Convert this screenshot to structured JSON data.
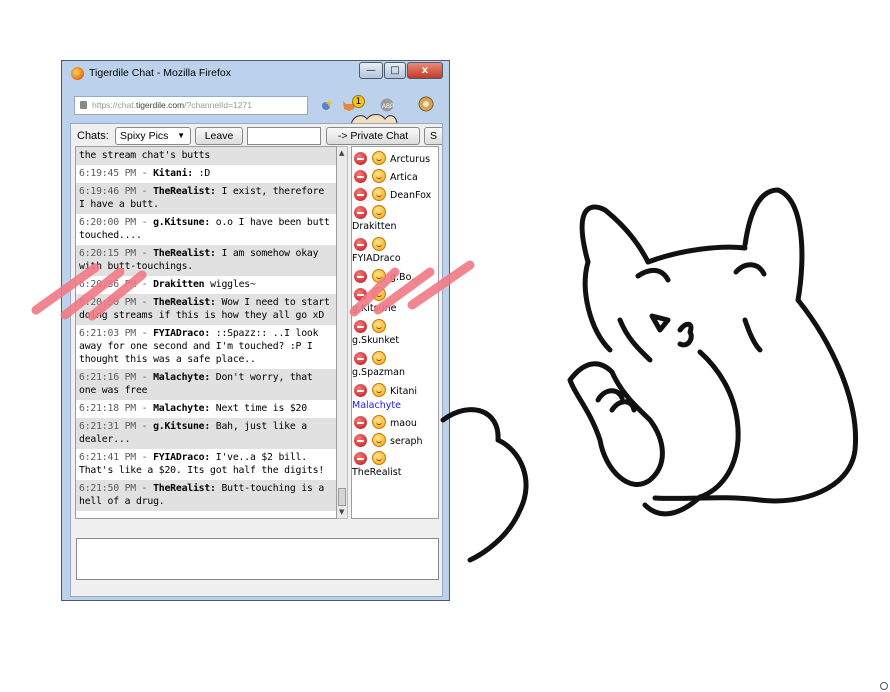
{
  "window": {
    "title": "Tigerdile Chat - Mozilla Firefox",
    "minimize_glyph": "—",
    "maximize_glyph": "□",
    "close_glyph": "x"
  },
  "urlbar": {
    "prefix": "https://chat.",
    "domain": "tigerdile.com",
    "suffix": "/?channelId=1271"
  },
  "addons": {
    "notification_count": "1"
  },
  "toolbar": {
    "chats_label": "Chats:",
    "channel_value": "Spixy Pics",
    "leave_label": "Leave",
    "private_chat_label": "-> Private Chat",
    "cut_button_label": "S"
  },
  "messages": [
    {
      "time": "",
      "nick": "",
      "text": "the stream chat's butts"
    },
    {
      "time": "6:19:45 PM - ",
      "nick": "Kitani:",
      "text": " :D"
    },
    {
      "time": "6:19:46 PM - ",
      "nick": "TheRealist:",
      "text": " I exist, therefore I have a butt."
    },
    {
      "time": "6:20:00 PM - ",
      "nick": "g.Kitsune:",
      "text": " o.o I have been butt touched...."
    },
    {
      "time": "6:20:15 PM - ",
      "nick": "TheRealist:",
      "text": " I am somehow okay with butt-touchings."
    },
    {
      "time": "6:20:36 PM - ",
      "nick": "Drakitten",
      "text": " wiggles~"
    },
    {
      "time": "6:20:50 PM - ",
      "nick": "TheRealist:",
      "text": " Wow I need to start doing streams if this is how they all go xD"
    },
    {
      "time": "6:21:03 PM - ",
      "nick": "FYIADraco:",
      "text": " ::Spazz:: ..I look away for one second and I'm touched? :P I thought this was a safe place.."
    },
    {
      "time": "6:21:16 PM - ",
      "nick": "Malachyte:",
      "text": " Don't worry, that one was free"
    },
    {
      "time": "6:21:18 PM - ",
      "nick": "Malachyte:",
      "text": " Next time is $20"
    },
    {
      "time": "6:21:31 PM - ",
      "nick": "g.Kitsune:",
      "text": " Bah, just like a dealer..."
    },
    {
      "time": "6:21:41 PM - ",
      "nick": "FYIADraco:",
      "text": " I've..a $2 bill. That's like a $20. Its got half the digits!"
    },
    {
      "time": "6:21:50 PM - ",
      "nick": "TheRealist:",
      "text": " Butt-touching is a hell of a drug."
    }
  ],
  "users": [
    {
      "name": "Arcturus",
      "layout": "inline",
      "color": "#000000"
    },
    {
      "name": "Artica",
      "layout": "inline",
      "color": "#000000"
    },
    {
      "name": "DeanFox",
      "layout": "inline",
      "color": "#000000"
    },
    {
      "name": "Drakitten",
      "layout": "below",
      "color": "#000000"
    },
    {
      "name": "FYIADraco",
      "layout": "below",
      "color": "#000000"
    },
    {
      "name": "g.Bo...",
      "layout": "inline",
      "color": "#000000"
    },
    {
      "name": "g.Kitsune",
      "layout": "below",
      "color": "#000000"
    },
    {
      "name": "g.Skunket",
      "layout": "below",
      "color": "#000000"
    },
    {
      "name": "g.Spazman",
      "layout": "below",
      "color": "#000000"
    },
    {
      "name": "Kitani",
      "layout": "inline",
      "color": "#000000"
    },
    {
      "name": "Malachyte",
      "layout": "plain",
      "color": "#1a1aff"
    },
    {
      "name": "maou",
      "layout": "inline",
      "color": "#000000"
    },
    {
      "name": "seraph",
      "layout": "inline",
      "color": "#000000"
    },
    {
      "name": "TheRealist",
      "layout": "below",
      "color": "#000000"
    }
  ],
  "colors": {
    "scribble": "#f07a86",
    "ink": "#111111",
    "window_frame": "#bcd2ec"
  }
}
